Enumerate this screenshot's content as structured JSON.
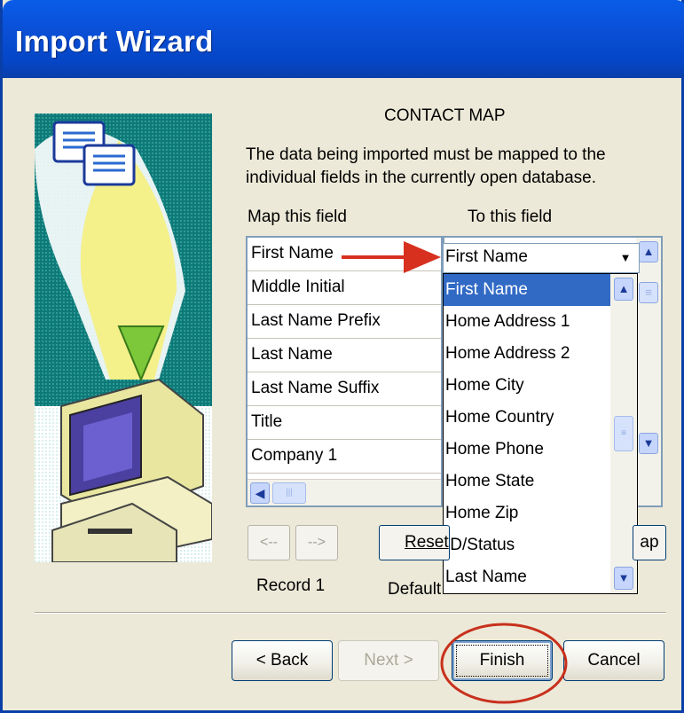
{
  "window": {
    "title": "Import Wizard"
  },
  "section_title": "CONTACT MAP",
  "description": "The data being imported must be mapped to the individual fields in the currently open database.",
  "columns": {
    "map_this_field": "Map this field",
    "to_this_field": "To this field"
  },
  "source_fields": [
    "First Name",
    "Middle Initial",
    "Last Name Prefix",
    "Last Name",
    "Last Name Suffix",
    "Title",
    "Company 1"
  ],
  "target_combo": {
    "value": "First Name"
  },
  "dropdown_options": [
    "First Name",
    "Home Address 1",
    "Home Address 2",
    "Home City",
    "Home Country",
    "Home Phone",
    "Home State",
    "Home Zip",
    "ID/Status",
    "Last Name"
  ],
  "dropdown_selected": "First Name",
  "record_nav": {
    "prev": "<--",
    "next": "-->",
    "record_label": "Record 1"
  },
  "reset_button": "Reset",
  "default_label": "Default",
  "map_button_partial": "ap",
  "buttons": {
    "back": "< Back",
    "next": "Next >",
    "finish": "Finish",
    "cancel": "Cancel"
  },
  "annotation_color": "#d7301f"
}
